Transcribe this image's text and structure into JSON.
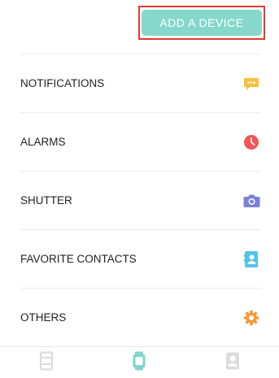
{
  "header": {
    "add_device_label": "ADD A DEVICE"
  },
  "menu": {
    "items": [
      {
        "label": "NOTIFICATIONS",
        "icon": "notification-chat-icon",
        "color": "#f9c23c"
      },
      {
        "label": "ALARMS",
        "icon": "alarm-clock-icon",
        "color": "#f2555a"
      },
      {
        "label": "SHUTTER",
        "icon": "camera-icon",
        "color": "#7b82d6"
      },
      {
        "label": "FAVORITE CONTACTS",
        "icon": "contact-card-icon",
        "color": "#52c3ea"
      },
      {
        "label": "OTHERS",
        "icon": "gear-icon",
        "color": "#f39a3a"
      }
    ]
  },
  "tabbar": {
    "tabs": [
      {
        "name": "tab-activity",
        "icon": "tracker-outline-icon",
        "active": false
      },
      {
        "name": "tab-device",
        "icon": "watch-icon",
        "active": true,
        "color": "#7fd6c8"
      },
      {
        "name": "tab-profile",
        "icon": "profile-icon",
        "active": false
      }
    ],
    "inactive_color": "#dcdcdc"
  }
}
